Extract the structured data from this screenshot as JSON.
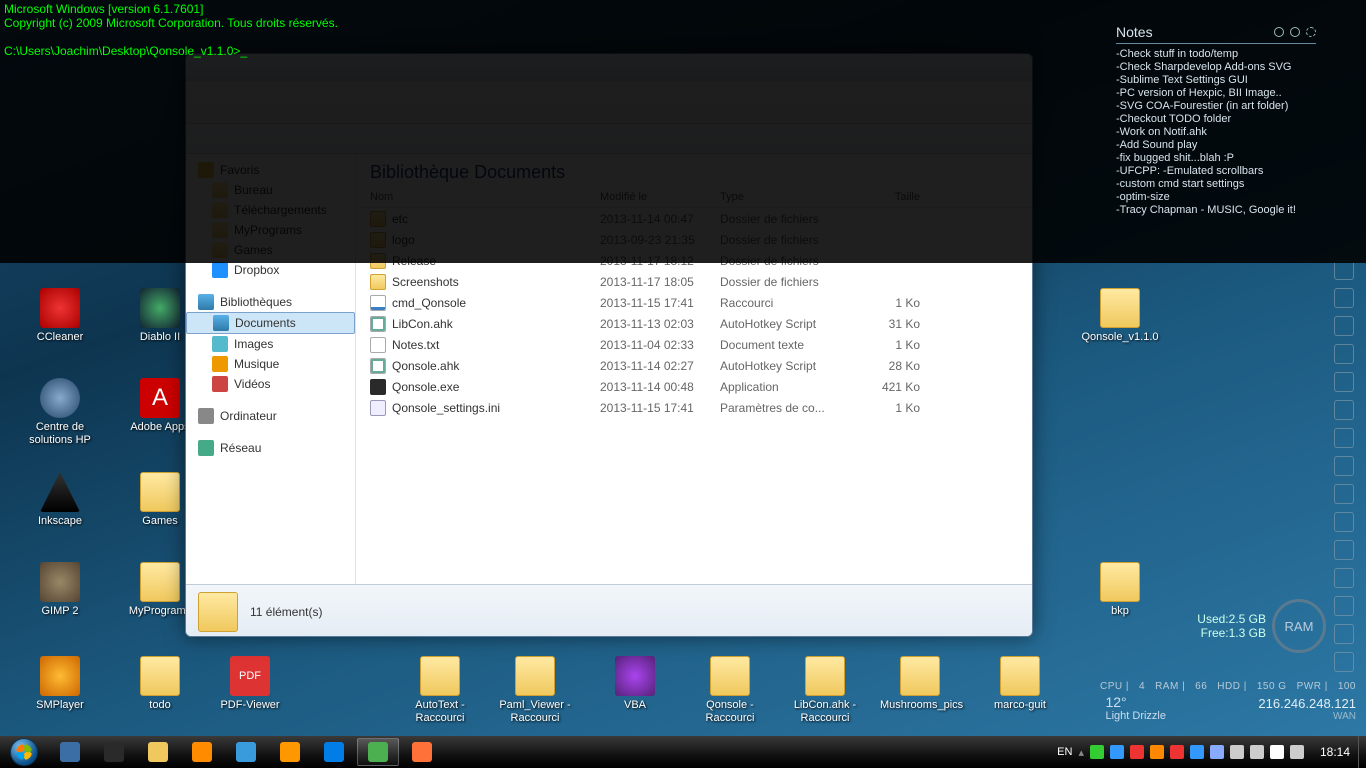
{
  "console": {
    "line1": "Microsoft Windows [version 6.1.7601]",
    "line2": "Copyright (c) 2009 Microsoft Corporation. Tous droits réservés.",
    "blank": "",
    "prompt": "C:\\Users\\Joachim\\Desktop\\Qonsole_v1.1.0>_"
  },
  "desktop_icons": {
    "ccleaner": "CCleaner",
    "diablo": "Diablo II",
    "centre_hp": "Centre de\nsolutions HP",
    "adobe": "Adobe Apps",
    "inkscape": "Inkscape",
    "games": "Games",
    "gimp": "GIMP 2",
    "myprograms": "MyPrograms",
    "smplayer": "SMPlayer",
    "todo": "todo",
    "pdfviewer": "PDF-Viewer",
    "autotext": "AutoText -\nRaccourci",
    "paml": "Paml_Viewer -\nRaccourci",
    "vba": "VBA",
    "qonsole_sc": "Qonsole -\nRaccourci",
    "libcon_sc": "LibCon.ahk -\nRaccourci",
    "mushrooms": "Mushrooms_pics",
    "marco": "marco-guit",
    "qonsole_folder": "Qonsole_v1.1.0",
    "bkp": "bkp"
  },
  "explorer": {
    "lib_title": "Bibliothèque Documents",
    "nav": {
      "favoris": "Favoris",
      "bureau": "Bureau",
      "telech": "Téléchargements",
      "recents": "MyPrograms",
      "games": "Games",
      "dropbox": "Dropbox",
      "biblio": "Bibliothèques",
      "documents": "Documents",
      "images": "Images",
      "musique": "Musique",
      "videos": "Vidéos",
      "ordinateur": "Ordinateur",
      "reseau": "Réseau"
    },
    "columns": {
      "name": "Nom",
      "date": "Modifié le",
      "type": "Type",
      "size": "Taille"
    },
    "rows": [
      {
        "icon": "folder",
        "name": "etc",
        "date": "2013-11-14 00:47",
        "type": "Dossier de fichiers",
        "size": ""
      },
      {
        "icon": "folder",
        "name": "logo",
        "date": "2013-09-23 21:35",
        "type": "Dossier de fichiers",
        "size": ""
      },
      {
        "icon": "folder",
        "name": "Release",
        "date": "2013-11-17 18:12",
        "type": "Dossier de fichiers",
        "size": ""
      },
      {
        "icon": "folder",
        "name": "Screenshots",
        "date": "2013-11-17 18:05",
        "type": "Dossier de fichiers",
        "size": ""
      },
      {
        "icon": "lnk",
        "name": "cmd_Qonsole",
        "date": "2013-11-15 17:41",
        "type": "Raccourci",
        "size": "1 Ko"
      },
      {
        "icon": "ahk",
        "name": "LibCon.ahk",
        "date": "2013-11-13 02:03",
        "type": "AutoHotkey Script",
        "size": "31 Ko"
      },
      {
        "icon": "file",
        "name": "Notes.txt",
        "date": "2013-11-04 02:33",
        "type": "Document texte",
        "size": "1 Ko"
      },
      {
        "icon": "ahk",
        "name": "Qonsole.ahk",
        "date": "2013-11-14 02:27",
        "type": "AutoHotkey Script",
        "size": "28 Ko"
      },
      {
        "icon": "exe",
        "name": "Qonsole.exe",
        "date": "2013-11-14 00:48",
        "type": "Application",
        "size": "421 Ko"
      },
      {
        "icon": "ini",
        "name": "Qonsole_settings.ini",
        "date": "2013-11-15 17:41",
        "type": "Paramètres de co...",
        "size": "1 Ko"
      }
    ],
    "status": "11 élément(s)"
  },
  "notes": {
    "title": "Notes",
    "lines": [
      "-Check stuff in todo/temp",
      "-Check Sharpdevelop Add-ons SVG",
      "-Sublime Text Settings GUI",
      "-PC version of Hexpic, BII Image..",
      "-SVG COA-Fourestier (in art folder)",
      "-Checkout TODO folder",
      "-Work on Notif.ahk",
      "    -Add Sound play",
      "    -fix bugged shit...blah :P",
      "-UFCPP:  -Emulated scrollbars",
      "    -custom cmd start settings",
      "    -optim-size",
      "-Tracy Chapman - MUSIC, Google it!"
    ]
  },
  "ram": {
    "used": "Used:2.5 GB",
    "free": "Free:1.3 GB",
    "label": "RAM"
  },
  "stats": {
    "cpu_l": "CPU |",
    "cpu_v": "4",
    "ram_l": "RAM |",
    "ram_v": "66",
    "hdd_l": "HDD |",
    "hdd_v": "150 G",
    "pwr_l": "PWR |",
    "pwr_v": "100"
  },
  "weather": {
    "temp": "12°",
    "cond": "Light Drizzle"
  },
  "net": {
    "ip": "216.246.248.121",
    "wan": "WAN"
  },
  "taskbar": {
    "lang": "EN",
    "clock": "18:14",
    "pins": [
      {
        "name": "show-desktop",
        "color": "#3a6ea5"
      },
      {
        "name": "task-view",
        "color": "#2a2a2a"
      },
      {
        "name": "explorer",
        "color": "#f0c95e"
      },
      {
        "name": "wmplayer",
        "color": "#ff8c00"
      },
      {
        "name": "itunes",
        "color": "#3a9bdc"
      },
      {
        "name": "sublime",
        "color": "#ff9800"
      },
      {
        "name": "dropbox",
        "color": "#007ee5"
      },
      {
        "name": "chrome",
        "color": "#4caf50",
        "active": true
      },
      {
        "name": "firefox",
        "color": "#ff7139"
      }
    ]
  }
}
